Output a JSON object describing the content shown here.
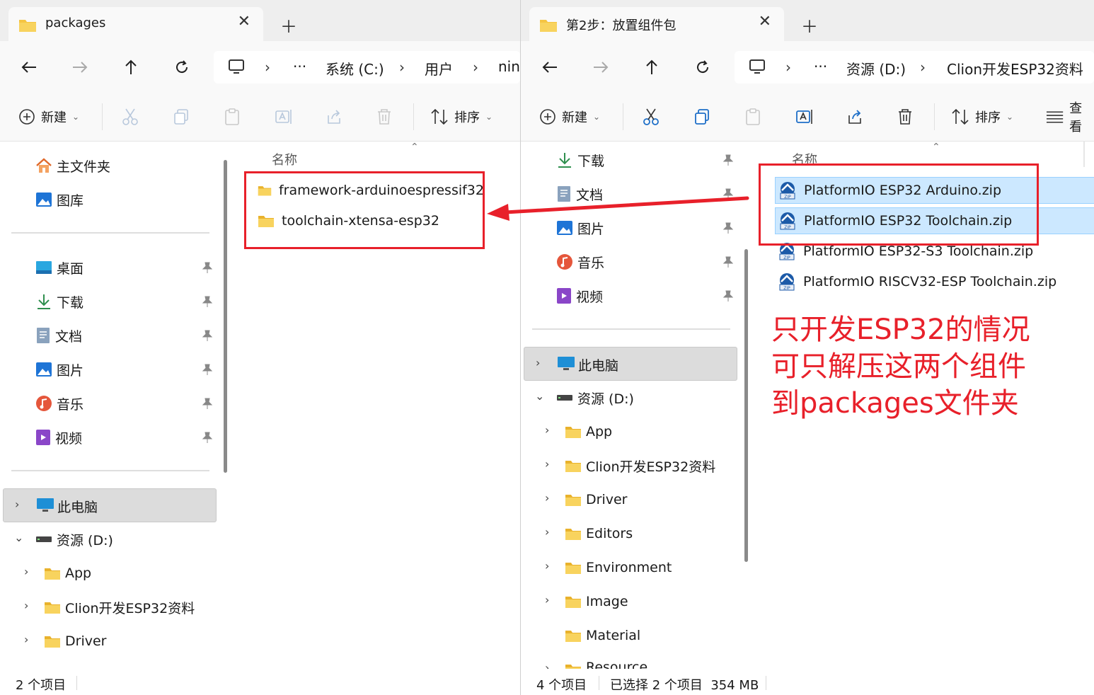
{
  "colors": {
    "annotation_red": "#e8202a",
    "selection_blue": "#cce8ff",
    "folder_yellow": "#f5c542"
  },
  "left": {
    "tab_title": "packages",
    "address": {
      "segments": [
        "系统 (C:)",
        "用户",
        "nin"
      ],
      "overflow": "···"
    },
    "toolbar": {
      "new_label": "新建",
      "sort_label": "排序"
    },
    "sidebar": {
      "home": "主文件夹",
      "gallery": "图库",
      "quick": [
        {
          "label": "桌面",
          "icon": "desktop-icon"
        },
        {
          "label": "下载",
          "icon": "download-icon"
        },
        {
          "label": "文档",
          "icon": "document-icon"
        },
        {
          "label": "图片",
          "icon": "pictures-icon"
        },
        {
          "label": "音乐",
          "icon": "music-icon"
        },
        {
          "label": "视频",
          "icon": "video-icon"
        }
      ],
      "this_pc": "此电脑",
      "drive": "资源 (D:)",
      "folders": [
        "App",
        "Clion开发ESP32资料",
        "Driver"
      ]
    },
    "column_name": "名称",
    "files": [
      "framework-arduinoespressif32",
      "toolchain-xtensa-esp32"
    ],
    "status": "2 个项目"
  },
  "right": {
    "tab_title": "第2步：放置组件包",
    "address": {
      "segments": [
        "资源 (D:)",
        "Clion开发ESP32资料"
      ],
      "overflow": "···"
    },
    "toolbar": {
      "new_label": "新建",
      "sort_label": "排序",
      "view_label": "查看"
    },
    "sidebar": {
      "quick": [
        {
          "label": "下载",
          "icon": "download-icon"
        },
        {
          "label": "文档",
          "icon": "document-icon"
        },
        {
          "label": "图片",
          "icon": "pictures-icon"
        },
        {
          "label": "音乐",
          "icon": "music-icon"
        },
        {
          "label": "视频",
          "icon": "video-icon"
        }
      ],
      "this_pc": "此电脑",
      "drive": "资源 (D:)",
      "folders": [
        "App",
        "Clion开发ESP32资料",
        "Driver",
        "Editors",
        "Environment",
        "Image",
        "Material",
        "Resource"
      ]
    },
    "column_name": "名称",
    "files": [
      {
        "name": "PlatformIO ESP32 Arduino.zip",
        "selected": true
      },
      {
        "name": "PlatformIO ESP32 Toolchain.zip",
        "selected": true
      },
      {
        "name": "PlatformIO ESP32-S3 Toolchain.zip",
        "selected": false
      },
      {
        "name": "PlatformIO RISCV32-ESP Toolchain.zip",
        "selected": false
      }
    ],
    "status_count": "4 个项目",
    "status_selected": "已选择 2 个项目  354 MB"
  },
  "annotation": {
    "lines": [
      "只开发ESP32的情况",
      "可只解压这两个组件",
      "到packages文件夹"
    ]
  }
}
